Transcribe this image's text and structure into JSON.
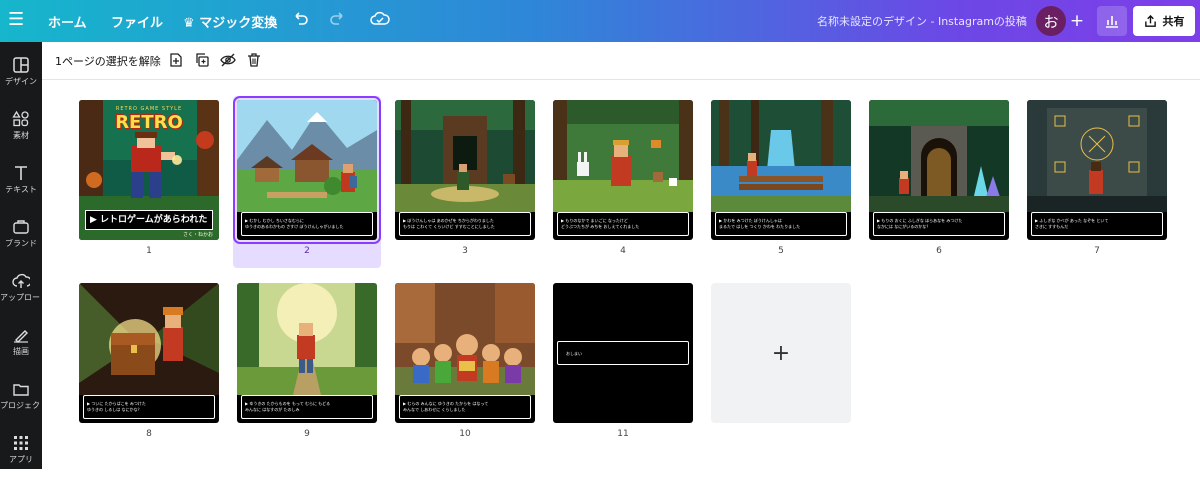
{
  "topbar": {
    "home": "ホーム",
    "file": "ファイル",
    "magic": "マジック変換",
    "doc_title": "名称未設定のデザイン - Instagramの投稿",
    "avatar_initial": "お",
    "share": "共有"
  },
  "rail": {
    "items": [
      {
        "label": "デザイン",
        "icon": "layout-icon"
      },
      {
        "label": "素材",
        "icon": "elements-icon"
      },
      {
        "label": "テキスト",
        "icon": "text-icon"
      },
      {
        "label": "ブランド",
        "icon": "brand-icon"
      },
      {
        "label": "アップロード",
        "icon": "upload-icon"
      },
      {
        "label": "描画",
        "icon": "draw-icon"
      },
      {
        "label": "プロジェクト",
        "icon": "folder-icon"
      },
      {
        "label": "アプリ",
        "icon": "apps-icon"
      }
    ]
  },
  "selection_bar": {
    "label": "1ページの選択を解除"
  },
  "cover": {
    "small_title": "RETRO GAME STYLE",
    "logo": "RETRO",
    "banner": "▶ レトロゲームがあらわれた",
    "credit": "さく・ねかお"
  },
  "pages": [
    {
      "number": "1",
      "selected": false
    },
    {
      "number": "2",
      "selected": true,
      "line1": "▶ むかし むかし ちいさなむらに",
      "line2": "ゆうきのあるわかもの さすけ ぼうけんしゃがいました"
    },
    {
      "number": "3",
      "selected": false,
      "line1": "▶ ぼうけんしゃは あのかぜを ちからがわりました",
      "line2": "もりは こわくて くらいけど すすむことにしました"
    },
    {
      "number": "4",
      "selected": false,
      "line1": "▶ もりのなかで まいごに なったけど",
      "line2": "どうぶつたちが みちを おしえてくれました"
    },
    {
      "number": "5",
      "selected": false,
      "line1": "▶ かわを みつけた ぼうけんしゃは",
      "line2": "まるたで はしを つくり かわを わたりました"
    },
    {
      "number": "6",
      "selected": false,
      "line1": "▶ もりの おくに ふしぎな ほらあなを みつけた",
      "line2": "なかには なにがいるのかな？"
    },
    {
      "number": "7",
      "selected": false,
      "line1": "▶ ふしぎな かべが あった なぞを といて",
      "line2": "さきに すすもんだ"
    },
    {
      "number": "8",
      "selected": false,
      "line1": "▶ ついに たからばこを みつけた",
      "line2": "ゆうきの しるしは なにかな？"
    },
    {
      "number": "9",
      "selected": false,
      "line1": "▶ ゆうきの たからものを もって むらに もどる",
      "line2": "みんなに はなすのが たのしみ"
    },
    {
      "number": "10",
      "selected": false,
      "line1": "▶ むらの みんなに ゆうきの たからを はなって",
      "line2": "みんなで しあわせに くらしました"
    },
    {
      "number": "11",
      "selected": false,
      "end_text": "おしまい"
    }
  ],
  "add_page_symbol": "+"
}
